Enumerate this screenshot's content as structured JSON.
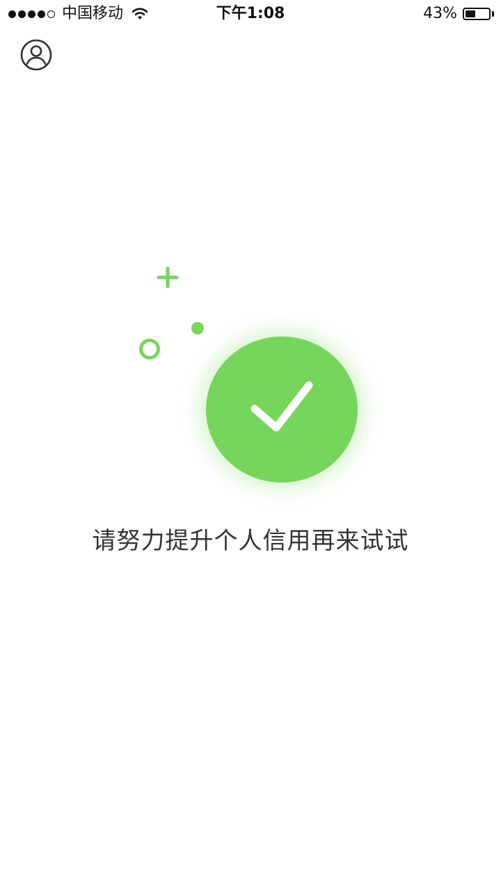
{
  "status_bar": {
    "signal_bars": 4,
    "signal_total": 5,
    "carrier": "中国移动",
    "wifi_icon": "wifi-icon",
    "time": "下午1:08",
    "battery_text": "43%",
    "battery_level": 0.43
  },
  "header": {
    "profile_icon": "user-profile-icon"
  },
  "result": {
    "icon": "check-circle-icon",
    "message": "请努力提升个人信用再来试试"
  },
  "colors": {
    "accent_green": "#76d65b",
    "text_primary": "#333333",
    "background": "#ffffff"
  }
}
